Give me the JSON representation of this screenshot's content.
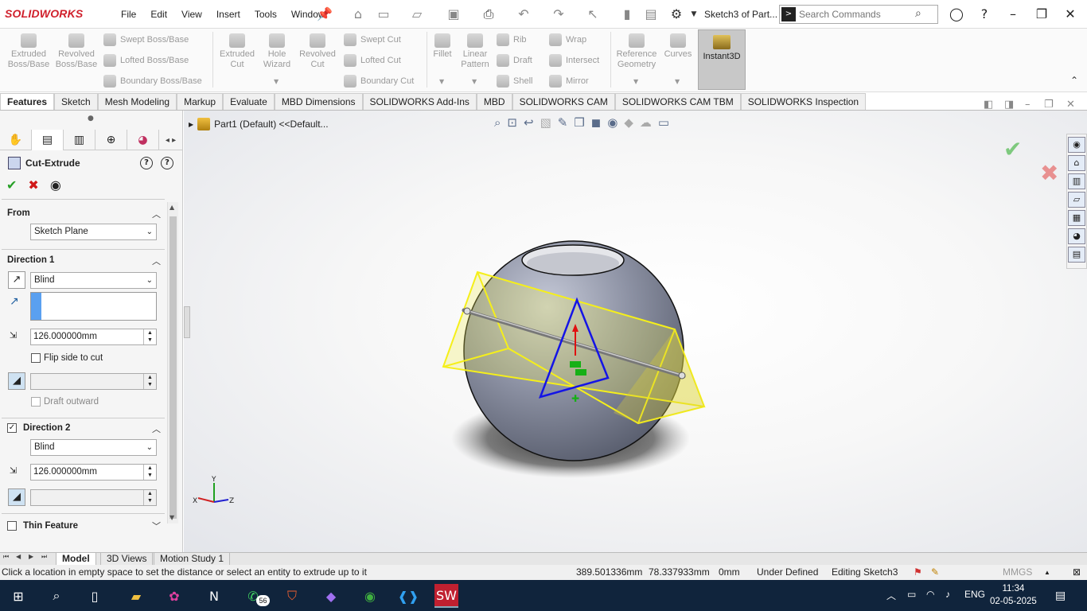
{
  "app": {
    "logo": "SOLIDWORKS",
    "doc_title": "Sketch3 of Part..."
  },
  "menu": [
    "File",
    "Edit",
    "View",
    "Insert",
    "Tools",
    "Window"
  ],
  "search": {
    "placeholder": "Search Commands"
  },
  "ribbon": {
    "extruded_boss": "Extruded Boss/Base",
    "revolved_boss": "Revolved Boss/Base",
    "swept_boss": "Swept Boss/Base",
    "lofted_boss": "Lofted Boss/Base",
    "boundary_boss": "Boundary Boss/Base",
    "extruded_cut": "Extruded Cut",
    "hole_wizard": "Hole Wizard",
    "revolved_cut": "Revolved Cut",
    "swept_cut": "Swept Cut",
    "lofted_cut": "Lofted Cut",
    "boundary_cut": "Boundary Cut",
    "fillet": "Fillet",
    "linear_pattern": "Linear Pattern",
    "rib": "Rib",
    "draft": "Draft",
    "shell": "Shell",
    "wrap": "Wrap",
    "intersect": "Intersect",
    "mirror": "Mirror",
    "reference_geometry": "Reference Geometry",
    "curves": "Curves",
    "instant3d": "Instant3D"
  },
  "tabs": [
    "Features",
    "Sketch",
    "Mesh Modeling",
    "Markup",
    "Evaluate",
    "MBD Dimensions",
    "SOLIDWORKS Add-Ins",
    "MBD",
    "SOLIDWORKS CAM",
    "SOLIDWORKS CAM TBM",
    "SOLIDWORKS Inspection"
  ],
  "property_manager": {
    "title": "Cut-Extrude",
    "from": {
      "header": "From",
      "value": "Sketch Plane"
    },
    "direction1": {
      "header": "Direction 1",
      "type": "Blind",
      "depth": "126.000000mm",
      "flip_label": "Flip side to cut",
      "draft_label": "Draft outward"
    },
    "direction2": {
      "header": "Direction 2",
      "type": "Blind",
      "depth": "126.000000mm"
    },
    "thin_feature": "Thin Feature"
  },
  "tree": {
    "item": "Part1 (Default) <<Default..."
  },
  "bottom_tabs": [
    "Model",
    "3D Views",
    "Motion Study 1"
  ],
  "status": {
    "message": "Click a location in empty space to set the distance or select an entity to extrude up to it",
    "x": "389.501336mm",
    "y": "78.337933mm",
    "z": "0mm",
    "state": "Under Defined",
    "editing": "Editing Sketch3",
    "units": "MMGS"
  },
  "taskbar": {
    "whatsapp_badge": "56",
    "lang": "ENG",
    "time": "11:34",
    "date": "02-05-2025"
  },
  "triad": {
    "x": "X",
    "y": "Y",
    "z": "Z"
  },
  "colors": {
    "accent": "#d0202c",
    "sketch_yellow": "#f5ef1a",
    "sketch_blue": "#1414e6",
    "sphere": "#8e93a6"
  }
}
